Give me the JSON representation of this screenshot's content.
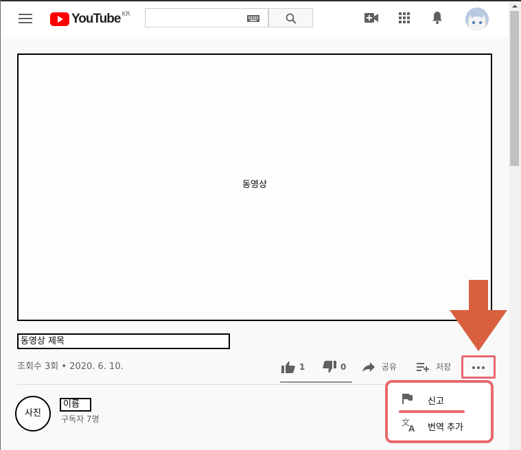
{
  "header": {
    "logo_text": "YouTube",
    "logo_region": "KR",
    "search_placeholder": ""
  },
  "video": {
    "placeholder_label": "동영상",
    "title": "동영상 제목",
    "meta": "조회수 3회 • 2020. 6. 10."
  },
  "actions": {
    "like_count": "1",
    "dislike_count": "0",
    "share_label": "공유",
    "save_label": "저장"
  },
  "channel": {
    "photo_label": "사진",
    "name": "이름",
    "subscribers": "구독자 7명"
  },
  "more_menu": {
    "items": [
      {
        "label": "신고",
        "icon": "flag-icon"
      },
      {
        "label": "번역 추가",
        "icon": "translate-icon"
      }
    ]
  },
  "colors": {
    "highlight": "#e8686e",
    "arrow": "#d9603f",
    "logo_red": "#ff0000"
  }
}
